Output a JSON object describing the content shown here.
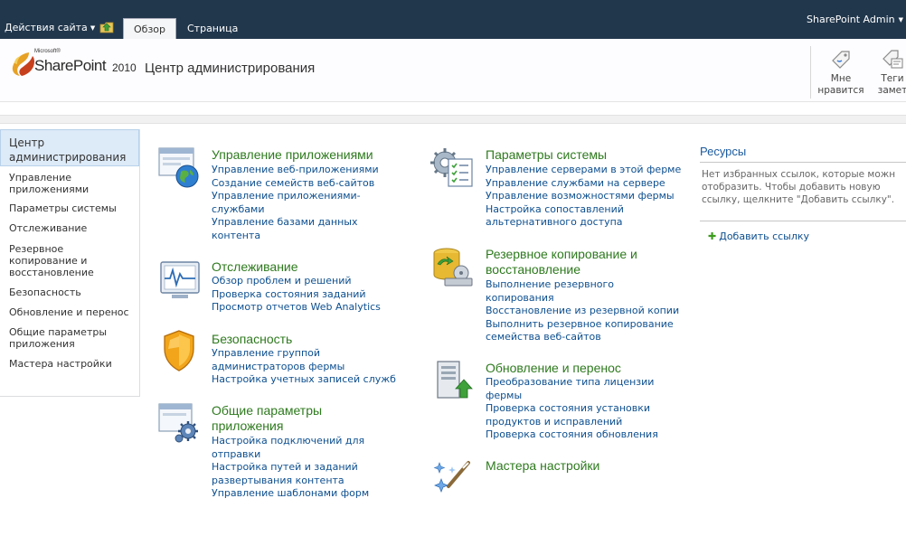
{
  "ribbon": {
    "site_actions": "Действия сайта",
    "tabs": [
      "Обзор",
      "Страница"
    ],
    "user": "SharePoint Admin"
  },
  "header": {
    "logo_microsoft": "Microsoft®",
    "logo_sharepoint": "SharePoint",
    "logo_year": "2010",
    "title": "Центр администрирования",
    "toolbar": [
      {
        "line1": "Мне",
        "line2": "нравится",
        "icon": "like-tag-icon"
      },
      {
        "line1": "Теги",
        "line2": "замет",
        "icon": "tags-notes-icon"
      }
    ]
  },
  "quicklaunch": {
    "header": [
      "Центр",
      "администрирования"
    ],
    "items": [
      [
        "Управление",
        "приложениями"
      ],
      [
        "Параметры системы"
      ],
      [
        "Отслеживание"
      ],
      [
        "Резервное",
        "копирование и",
        "восстановление"
      ],
      [
        "Безопасность"
      ],
      [
        "Обновление и перенос"
      ],
      [
        "Общие параметры",
        "приложения"
      ],
      [
        "Мастера настройки"
      ]
    ]
  },
  "sections": {
    "app_mgmt": {
      "title": [
        "Управление приложениями"
      ],
      "links": [
        "Управление веб-приложениями",
        "Создание семейств веб-сайтов",
        "Управление приложениями-",
        "службами",
        "Управление базами данных",
        "контента"
      ]
    },
    "monitoring": {
      "title": [
        "Отслеживание"
      ],
      "links": [
        "Обзор проблем и решений",
        "Проверка состояния заданий",
        "Просмотр отчетов Web Analytics"
      ]
    },
    "security": {
      "title": [
        "Безопасность"
      ],
      "links": [
        "Управление группой",
        "администраторов фермы",
        "Настройка учетных записей служб"
      ]
    },
    "general_app": {
      "title": [
        "Общие параметры",
        "приложения"
      ],
      "links": [
        "Настройка подключений для",
        "отправки",
        "Настройка путей и заданий",
        "развертывания контента",
        "Управление шаблонами форм"
      ]
    },
    "system": {
      "title": [
        "Параметры системы"
      ],
      "links": [
        "Управление серверами в этой ферме",
        "Управление службами на сервере",
        "Управление возможностями фермы",
        "Настройка сопоставлений",
        "альтернативного доступа"
      ]
    },
    "backup": {
      "title": [
        "Резервное копирование и",
        "восстановление"
      ],
      "links": [
        "Выполнение резервного",
        "копирования",
        "Восстановление из резервной копии",
        "Выполнить резервное копирование",
        "семейства веб-сайтов"
      ]
    },
    "upgrade": {
      "title": [
        "Обновление и перенос"
      ],
      "links": [
        "Преобразование типа лицензии",
        "фермы",
        "Проверка состояния установки",
        "продуктов и исправлений",
        "Проверка состояния обновления"
      ]
    },
    "wizards": {
      "title": [
        "Мастера настройки"
      ],
      "links": []
    }
  },
  "resources": {
    "title": "Ресурсы",
    "text": [
      "Нет избранных ссылок, которые можн",
      "отобразить. Чтобы добавить новую",
      "ссылку, щелкните \"Добавить ссылку\"."
    ],
    "add_link": "Добавить ссылку"
  },
  "colors": {
    "ribbon_bg": "#21374c",
    "section_title": "#2e7a1e",
    "link": "#0d4f8f",
    "ql_selected_bg": "#ddeaf7"
  }
}
